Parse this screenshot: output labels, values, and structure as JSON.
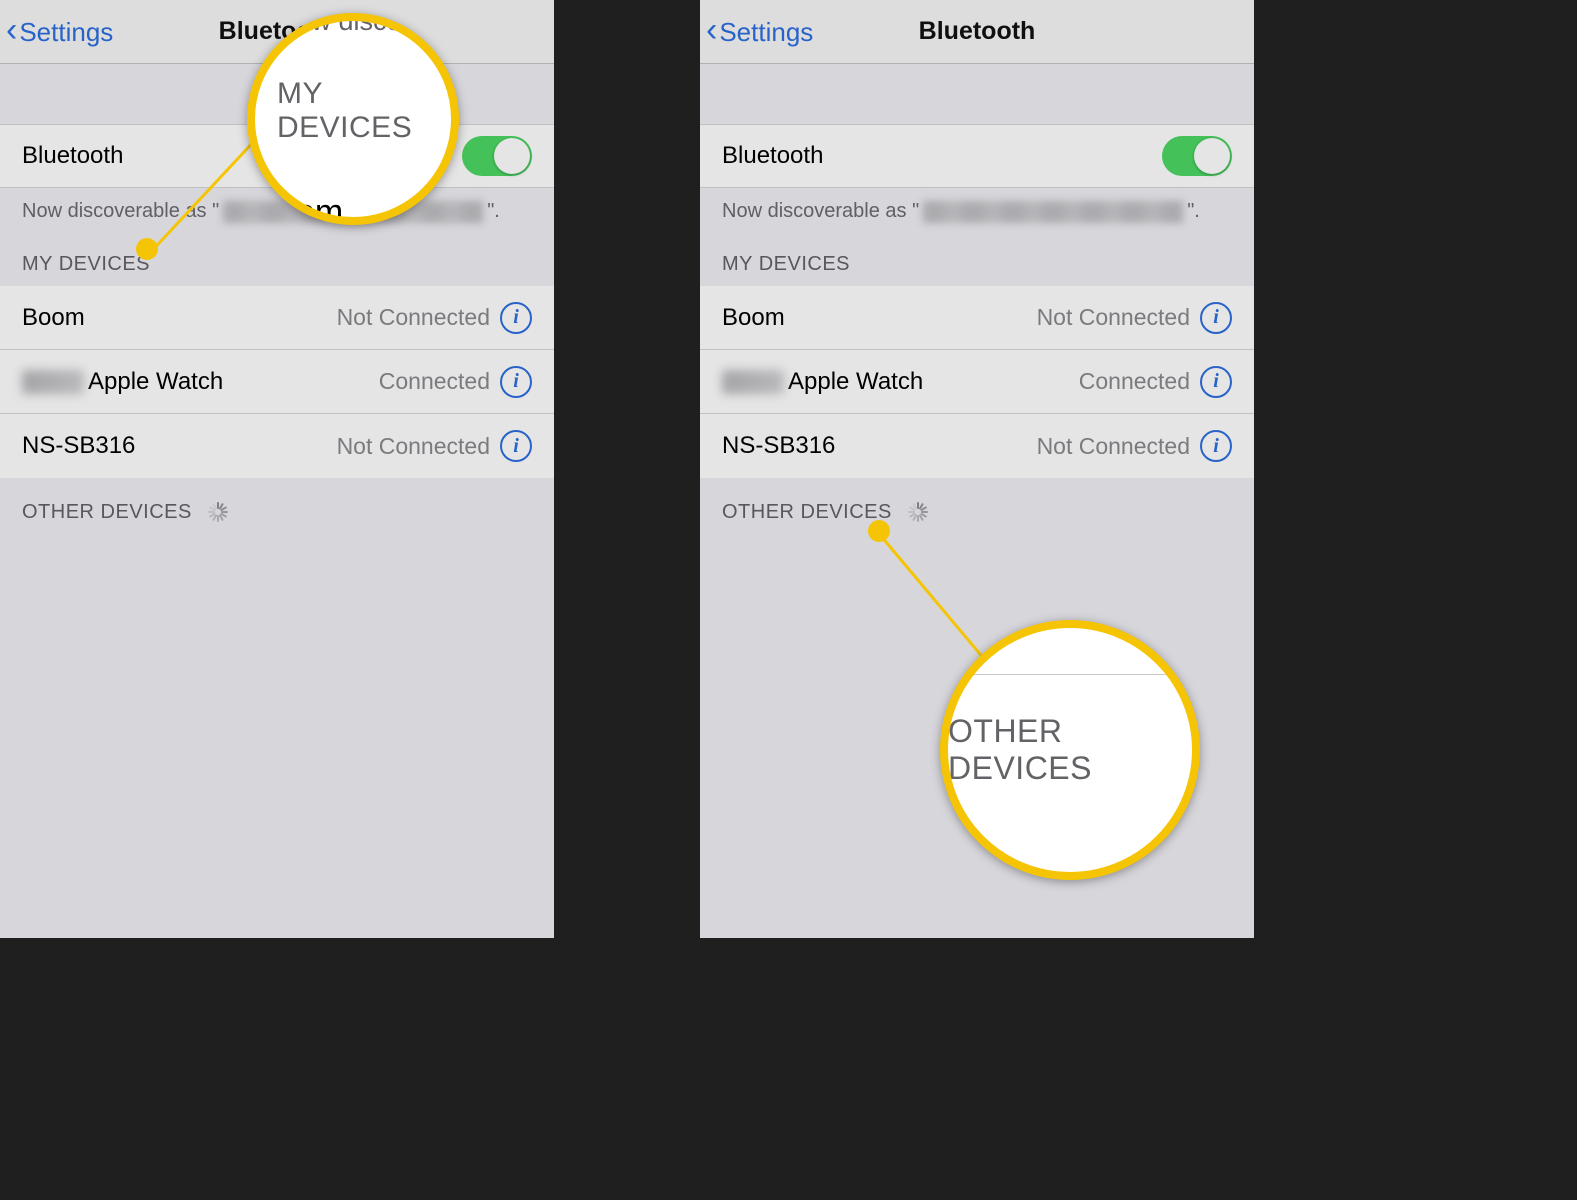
{
  "nav": {
    "back_label": "Settings",
    "title": "Bluetooth"
  },
  "bluetooth": {
    "row_label": "Bluetooth",
    "enabled": true,
    "discoverable_prefix": "Now discoverable as \"",
    "discoverable_suffix": "\"."
  },
  "sections": {
    "my_devices": "MY DEVICES",
    "other_devices": "OTHER DEVICES"
  },
  "status": {
    "connected": "Connected",
    "not_connected": "Not Connected"
  },
  "devices": [
    {
      "name": "Boom",
      "status_key": "not_connected",
      "blur_prefix": false
    },
    {
      "name": "Apple Watch",
      "status_key": "connected",
      "blur_prefix": true
    },
    {
      "name": "NS-SB316",
      "status_key": "not_connected",
      "blur_prefix": false
    }
  ],
  "callouts": {
    "left": {
      "line1": "Now discover",
      "line2": "MY DEVICES",
      "line3": "oom"
    },
    "right": {
      "text": "OTHER DEVICES"
    }
  },
  "colors": {
    "accent_blue": "#2d6fe0",
    "switch_green": "#4cd964",
    "highlight_yellow": "#f5c505"
  }
}
